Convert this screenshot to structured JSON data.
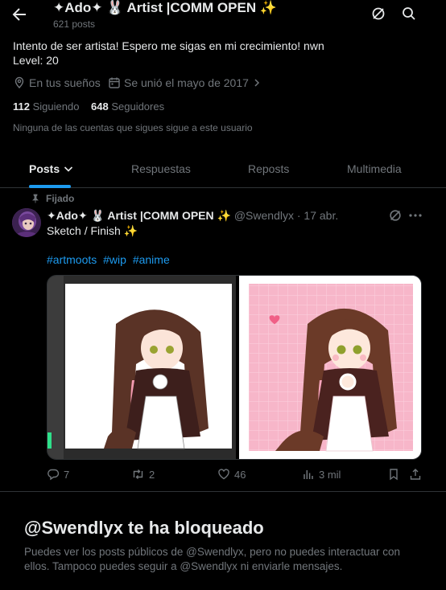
{
  "header": {
    "title": "✦Ado✦ 🐰 Artist |COMM OPEN ✨",
    "post_count": "621 posts"
  },
  "profile": {
    "bio_line1": "Intento de ser artista! Espero me sigas en mi crecimiento! nwn",
    "bio_line2": "Level: 20",
    "location": "En tus sueños",
    "joined": "Se unió el mayo de 2017",
    "following_count": "112",
    "following_label": "Siguiendo",
    "followers_count": "648",
    "followers_label": "Seguidores",
    "no_followers_note": "Ninguna de las cuentas que sigues sigue a este usuario"
  },
  "tabs": [
    {
      "label": "Posts"
    },
    {
      "label": "Respuestas"
    },
    {
      "label": "Reposts"
    },
    {
      "label": "Multimedia"
    }
  ],
  "post": {
    "pinned_label": "Fijado",
    "display_name": "✦Ado✦ 🐰 Artist |COMM OPEN ✨",
    "handle": "@Swendlyx",
    "date": "· 17 abr.",
    "text": "Sketch / Finish ✨",
    "hashtags": [
      "#artmoots",
      "#wip",
      "#anime"
    ],
    "replies": "7",
    "reposts": "2",
    "likes": "46",
    "views": "3 mil"
  },
  "blocked": {
    "title": "@Swendlyx te ha bloqueado",
    "message": "Puedes ver los posts públicos de @Swendlyx, pero no puedes interactuar con ellos. Tampoco puedes seguir a @Swendlyx ni enviarle mensajes."
  },
  "colors": {
    "background": "#000000",
    "accent": "#1d9bf0",
    "muted": "#71767b",
    "text": "#e7e9ea",
    "border": "#2f3336"
  }
}
